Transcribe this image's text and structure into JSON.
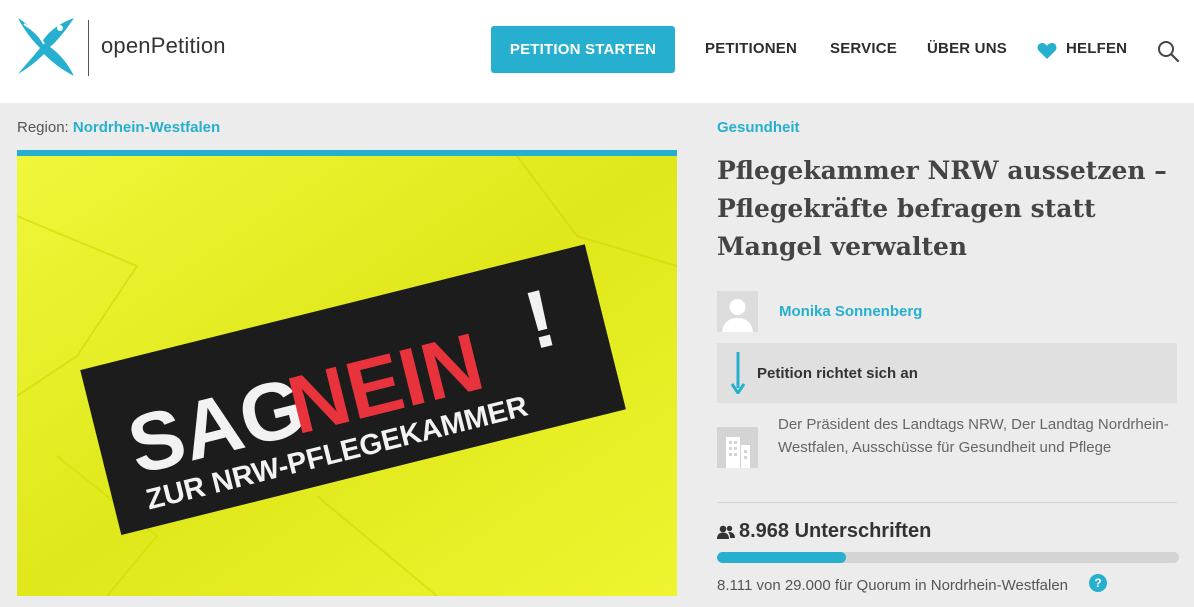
{
  "header": {
    "brand": "openPetition",
    "cta_label": "PETITION STARTEN",
    "nav": [
      "PETITIONEN",
      "SERVICE",
      "ÜBER UNS",
      "HELFEN"
    ]
  },
  "region": {
    "label": "Region:",
    "value": "Nordrhein-Westfalen"
  },
  "hero_image": {
    "line1_part1": "SAG",
    "line1_part2": "NEIN",
    "line1_part3": "!",
    "line2": "ZUR NRW-PFLEGEKAMMER"
  },
  "petition": {
    "category": "Gesundheit",
    "title": "Pflegekammer NRW aussetzen – Pflegekräfte befragen statt Mangel verwalten",
    "author": "Monika Sonnenberg",
    "addressee_label": "Petition richtet sich an",
    "addressee": "Der Präsident des Landtags NRW, Der Landtag Nordrhein-Westfalen, Ausschüsse für Gesundheit und Pflege",
    "signatures": "8.968 Unterschriften",
    "progress_fraction": 0.28,
    "quorum_text": "8.111 von 29.000 für Quorum in Nordrhein-Westfalen",
    "help_glyph": "?"
  },
  "colors": {
    "accent": "#26afcf",
    "hero_yellow": "#e5f020",
    "nein_red": "#e8333c"
  },
  "icons": [
    "bird-logo-icon",
    "heart-icon",
    "search-icon",
    "down-arrow-icon",
    "building-icon",
    "people-icon",
    "help-icon",
    "avatar-placeholder-icon"
  ]
}
